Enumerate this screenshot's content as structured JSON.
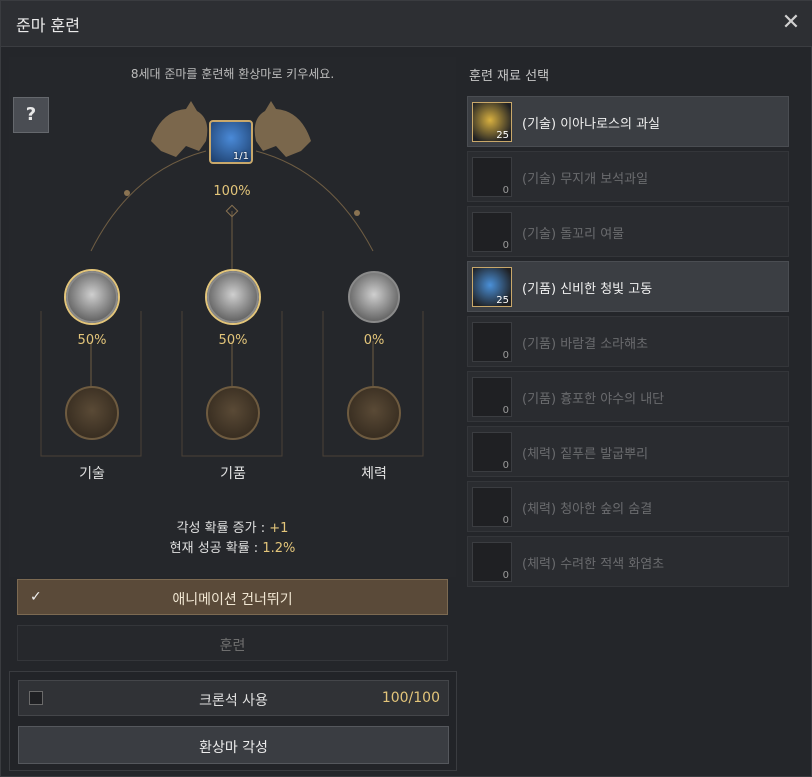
{
  "window": {
    "title": "준마 훈련",
    "close_icon": "close-icon"
  },
  "left": {
    "subtitle": "8세대 준마를 훈련해 환상마로 키우세요.",
    "help_label": "?",
    "center": {
      "count": "1/1",
      "percent": "100%"
    },
    "stats": [
      {
        "label": "기술",
        "percent": "50%",
        "progress": 0.5
      },
      {
        "label": "기품",
        "percent": "50%",
        "progress": 0.5
      },
      {
        "label": "체력",
        "percent": "0%",
        "progress": 0.0
      }
    ],
    "info": {
      "awaken_prob_label": "각성 확률 증가 : ",
      "awaken_prob_value": "+1",
      "success_prob_label": "현재 성공 확률 : ",
      "success_prob_value": "1.2%"
    },
    "skip_animation": {
      "label": "애니메이션 건너뛰기",
      "checked": true,
      "check_glyph": "✓"
    },
    "train_button": "훈련",
    "chronos": {
      "label": "크론석 사용",
      "count": "100/100",
      "checked": false
    },
    "awaken_button": "환상마 각성"
  },
  "right": {
    "title": "훈련 재료 선택",
    "items": [
      {
        "name": "(기술) 이아나로스의 과실",
        "count": "25",
        "active": true,
        "color": "#d8b040"
      },
      {
        "name": "(기술) 무지개 보석과일",
        "count": "0",
        "active": false,
        "color": "#555"
      },
      {
        "name": "(기술) 돌꼬리 여물",
        "count": "0",
        "active": false,
        "color": "#555"
      },
      {
        "name": "(기품) 신비한 청빛 고동",
        "count": "25",
        "active": true,
        "color": "#4a90d8"
      },
      {
        "name": "(기품) 바람결 소라해초",
        "count": "0",
        "active": false,
        "color": "#555"
      },
      {
        "name": "(기품) 흉포한 야수의 내단",
        "count": "0",
        "active": false,
        "color": "#555"
      },
      {
        "name": "(체력) 짙푸른 발굽뿌리",
        "count": "0",
        "active": false,
        "color": "#555"
      },
      {
        "name": "(체력) 청아한 숲의 숨결",
        "count": "0",
        "active": false,
        "color": "#555"
      },
      {
        "name": "(체력) 수려한 적색 화염초",
        "count": "0",
        "active": false,
        "color": "#555"
      }
    ]
  },
  "colors": {
    "accent_gold": "#e3c57a",
    "active_button": "#5a4a39"
  }
}
